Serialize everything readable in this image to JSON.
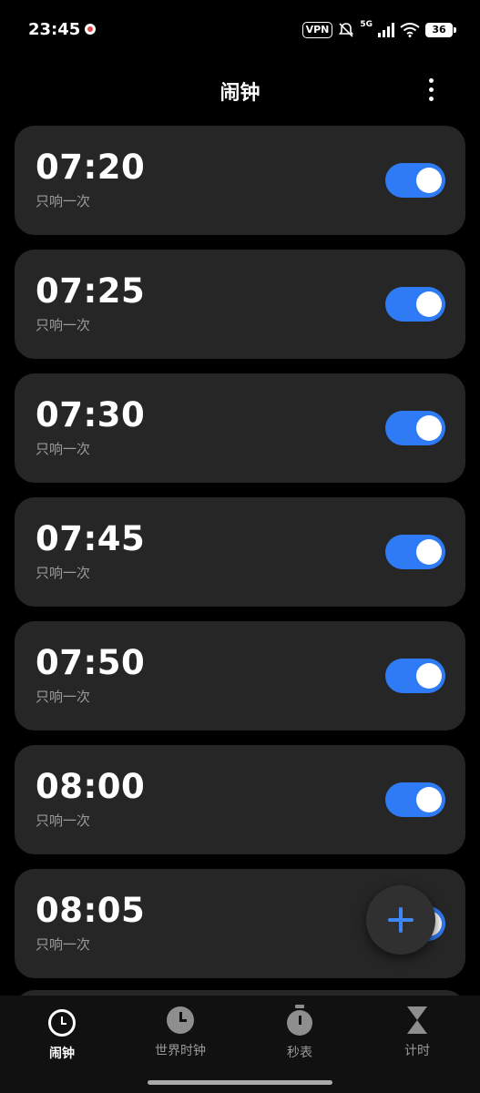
{
  "status_bar": {
    "time": "23:45",
    "vpn": "VPN",
    "network": "5G",
    "battery": "36"
  },
  "header": {
    "title": "闹钟"
  },
  "alarms": [
    {
      "time": "07:20",
      "repeat": "只响一次",
      "enabled": true
    },
    {
      "time": "07:25",
      "repeat": "只响一次",
      "enabled": true
    },
    {
      "time": "07:30",
      "repeat": "只响一次",
      "enabled": true
    },
    {
      "time": "07:45",
      "repeat": "只响一次",
      "enabled": true
    },
    {
      "time": "07:50",
      "repeat": "只响一次",
      "enabled": true
    },
    {
      "time": "08:00",
      "repeat": "只响一次",
      "enabled": true
    },
    {
      "time": "08:05",
      "repeat": "只响一次",
      "enabled": true
    }
  ],
  "bottom_nav": {
    "active": "alarm",
    "items": [
      {
        "key": "alarm",
        "label": "闹钟",
        "icon": "alarm-clock-icon"
      },
      {
        "key": "world",
        "label": "世界时钟",
        "icon": "clock-icon"
      },
      {
        "key": "stopwatch",
        "label": "秒表",
        "icon": "stopwatch-icon"
      },
      {
        "key": "timer",
        "label": "计时",
        "icon": "hourglass-icon"
      }
    ]
  },
  "colors": {
    "accent": "#2f7bf5",
    "card": "#262626",
    "background": "#000000"
  }
}
